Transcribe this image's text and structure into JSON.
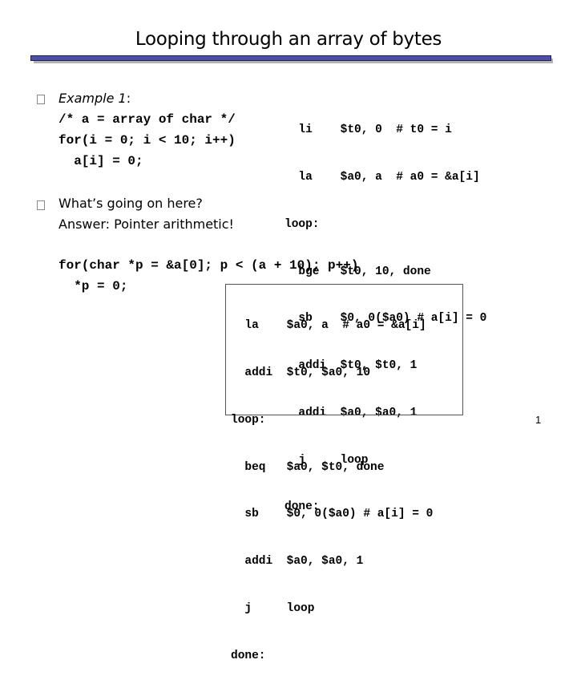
{
  "slide": {
    "title": "Looping through an array of bytes",
    "page_number": "1",
    "accent_color": "#4e4ea6"
  },
  "left": {
    "bullet1": {
      "label": "Example 1",
      "label_suffix": ":",
      "code": [
        "/* a = array of char */",
        "for(i = 0; i < 10; i++)",
        "  a[i] = 0;"
      ]
    },
    "bullet2": {
      "question": "What’s going on here?",
      "answer": "Answer: Pointer arithmetic!"
    },
    "pointer_code": [
      "for(char *p = &a[0]; p < (a + 10); p++)",
      "  *p = 0;"
    ]
  },
  "asm_top": [
    "  li    $t0, 0  # t0 = i",
    "  la    $a0, a  # a0 = &a[i]",
    "loop:",
    "  bge   $t0, 10, done",
    "  sb    $0, 0($a0) # a[i] = 0",
    "  addi  $t0, $t0, 1",
    "  addi  $a0, $a0, 1",
    "  j     loop",
    "done:"
  ],
  "asm_bottom": [
    "  la    $a0, a  # a0 = &a[i]",
    "  addi  $t0, $a0, 10",
    "loop:",
    "  beq   $a0, $t0, done",
    "  sb    $0, 0($a0) # a[i] = 0",
    "  addi  $a0, $a0, 1",
    "  j     loop",
    "done:"
  ]
}
